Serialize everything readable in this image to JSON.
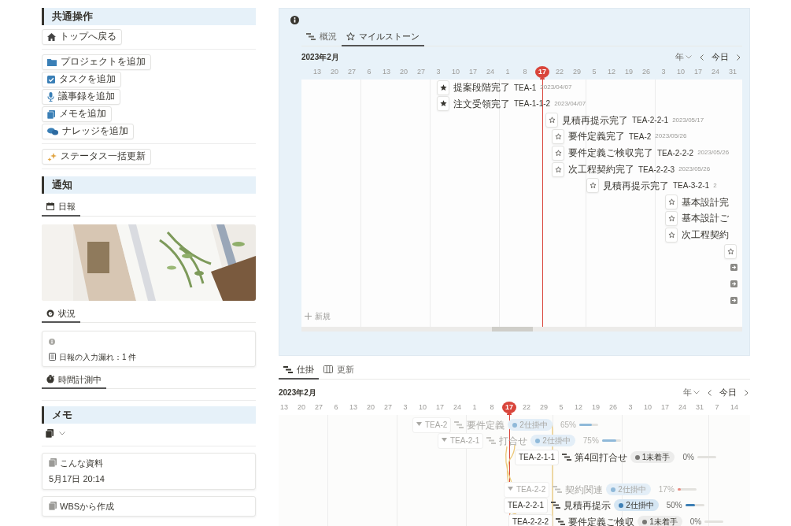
{
  "common_actions": {
    "title": "共通操作",
    "groups": [
      [
        "トップへ戻る"
      ],
      [
        "プロジェクトを追加",
        "タスクを追加",
        "議事録を追加",
        "メモを追加",
        "ナレッジを追加"
      ],
      [
        "ステータス一括更新"
      ]
    ]
  },
  "notice": {
    "title": "通知",
    "daily_tabs": [
      {
        "label": "日報",
        "selected": true
      }
    ],
    "status_tabs": [
      {
        "label": "状況",
        "selected": true
      }
    ],
    "status_card": {
      "message": "日報の入力漏れ：1 件"
    },
    "timer_tabs": [
      {
        "label": "時間計測中",
        "selected": true
      }
    ]
  },
  "memo": {
    "title": "メモ",
    "cards": [
      {
        "title": "こんな資料",
        "date": "5月17日 20:14"
      },
      {
        "title": "WBSから作成"
      }
    ]
  },
  "milestone_panel": {
    "tabs": [
      {
        "label": "概況",
        "selected": false
      },
      {
        "label": "マイルストーン",
        "selected": true
      }
    ],
    "month": "2023年2月",
    "scale": "年",
    "today_button": "今日",
    "dates": [
      {
        "label": "13",
        "today": false
      },
      {
        "label": "20",
        "today": false
      },
      {
        "label": "27",
        "today": false
      },
      {
        "label": "6",
        "today": false
      },
      {
        "label": "13",
        "today": false
      },
      {
        "label": "20",
        "today": false
      },
      {
        "label": "27",
        "today": false
      },
      {
        "label": "3",
        "today": false
      },
      {
        "label": "10",
        "today": false
      },
      {
        "label": "17",
        "today": false
      },
      {
        "label": "24",
        "today": false
      },
      {
        "label": "1",
        "today": false
      },
      {
        "label": "8",
        "today": false
      },
      {
        "label": "17",
        "today": true
      },
      {
        "label": "22",
        "today": false
      },
      {
        "label": "29",
        "today": false
      },
      {
        "label": "5",
        "today": false
      },
      {
        "label": "12",
        "today": false
      },
      {
        "label": "19",
        "today": false
      },
      {
        "label": "26",
        "today": false
      },
      {
        "label": "3",
        "today": false
      },
      {
        "label": "10",
        "today": false
      },
      {
        "label": "17",
        "today": false
      },
      {
        "label": "24",
        "today": false
      },
      {
        "label": "31",
        "today": false
      }
    ],
    "milestones": [
      {
        "kind": "milestone",
        "done": true,
        "name": "提案段階完了",
        "id": "TEA-1",
        "date": "2023/04/07"
      },
      {
        "kind": "milestone",
        "done": true,
        "name": "注文受領完了",
        "id": "TEA-1-1-2",
        "date": "2023/04/07"
      },
      {
        "kind": "milestone",
        "done": false,
        "name": "見積再提示完了",
        "id": "TEA-2-2-1",
        "date": "2023/05/17"
      },
      {
        "kind": "milestone",
        "done": false,
        "name": "要件定義完了",
        "id": "TEA-2",
        "date": "2023/05/26"
      },
      {
        "kind": "milestone",
        "done": false,
        "name": "要件定義ご検収完了",
        "id": "TEA-2-2-2",
        "date": "2023/05/26"
      },
      {
        "kind": "milestone",
        "done": false,
        "name": "次工程契約完了",
        "id": "TEA-2-2-3",
        "date": "2023/05/26"
      },
      {
        "kind": "milestone",
        "done": false,
        "name": "見積再提示完了",
        "id": "TEA-3-2-1",
        "date": "2"
      },
      {
        "kind": "milestone",
        "done": false,
        "name": "基本設計完"
      },
      {
        "kind": "milestone",
        "done": false,
        "name": "基本設計ご"
      },
      {
        "kind": "milestone",
        "done": false,
        "name": "次工程契約"
      },
      {
        "kind": "milestone",
        "done": false
      },
      {
        "kind": "link"
      },
      {
        "kind": "link"
      },
      {
        "kind": "link"
      }
    ],
    "new_button": "新規"
  },
  "gantt_panel": {
    "tabs": [
      {
        "label": "仕掛",
        "selected": true
      },
      {
        "label": "更新",
        "selected": false
      }
    ],
    "month": "2023年2月",
    "scale": "年",
    "today_button": "今日",
    "dates": [
      {
        "label": "13",
        "today": false
      },
      {
        "label": "20",
        "today": false
      },
      {
        "label": "27",
        "today": false
      },
      {
        "label": "6",
        "today": false
      },
      {
        "label": "13",
        "today": false
      },
      {
        "label": "20",
        "today": false
      },
      {
        "label": "27",
        "today": false
      },
      {
        "label": "3",
        "today": false
      },
      {
        "label": "10",
        "today": false
      },
      {
        "label": "17",
        "today": false
      },
      {
        "label": "24",
        "today": false
      },
      {
        "label": "1",
        "today": false
      },
      {
        "label": "8",
        "today": false
      },
      {
        "label": "17",
        "today": true
      },
      {
        "label": "22",
        "today": false
      },
      {
        "label": "29",
        "today": false
      },
      {
        "label": "5",
        "today": false
      },
      {
        "label": "12",
        "today": false
      },
      {
        "label": "19",
        "today": false
      },
      {
        "label": "26",
        "today": false
      },
      {
        "label": "3",
        "today": false
      },
      {
        "label": "10",
        "today": false
      },
      {
        "label": "17",
        "today": false
      },
      {
        "label": "24",
        "today": false
      },
      {
        "label": "31",
        "today": false
      },
      {
        "label": "7",
        "today": false
      },
      {
        "label": "14",
        "today": false
      }
    ],
    "rows": [
      {
        "kind": "group",
        "expanded": true,
        "id": "TEA-2",
        "name": "要件定義",
        "status": "2仕掛中",
        "color": "#8fb9d9",
        "progress": "65%",
        "level": 0.65
      },
      {
        "kind": "group",
        "expanded": true,
        "id": "TEA-2-1",
        "name": "打合せ",
        "status": "2仕掛中",
        "color": "#8fb9d9",
        "progress": "75%",
        "level": 0.75
      },
      {
        "kind": "task",
        "id": "TEA-2-1-1",
        "name": "第4回打合せ",
        "status": "1未着手",
        "color": "#787774",
        "progress": "0%",
        "level": 0
      },
      {
        "kind": "group",
        "expanded": true,
        "id": "TEA-2-2",
        "name": "契約関連",
        "status": "2仕掛中",
        "color": "#8fb9d9",
        "progress": "17%",
        "level": 0.17
      },
      {
        "kind": "task",
        "id": "TEA-2-2-1",
        "name": "見積再提示",
        "status": "2仕掛中",
        "color": "#3d7fb5",
        "progress": "50%",
        "level": 0.5
      },
      {
        "kind": "task",
        "id": "TEA-2-2-2",
        "name": "要件定義ご検収",
        "status": "1未着手",
        "color": "#787774",
        "progress": "0%",
        "level": 0
      }
    ]
  }
}
